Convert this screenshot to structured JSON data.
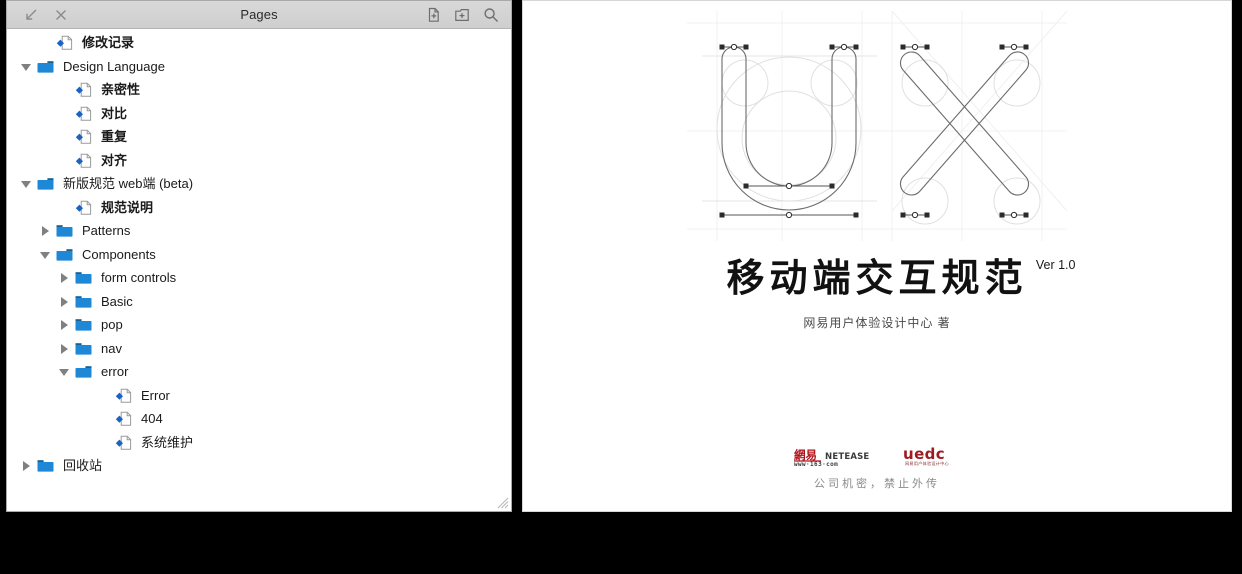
{
  "window": {
    "title": "Pages",
    "left_controls": [
      {
        "name": "collapse-icon",
        "label": "collapse"
      },
      {
        "name": "close-icon",
        "label": "close"
      }
    ],
    "right_controls": [
      {
        "name": "add-page-icon",
        "label": "Add Page"
      },
      {
        "name": "add-folder-icon",
        "label": "Add Folder"
      },
      {
        "name": "search-icon",
        "label": "Search"
      }
    ]
  },
  "tree": {
    "items": [
      {
        "label": "修改记录",
        "type": "page",
        "indent": 1,
        "disclosure": "none",
        "bold": true
      },
      {
        "label": "Design Language",
        "type": "folder-open",
        "indent": 0,
        "disclosure": "open",
        "bold": false
      },
      {
        "label": "亲密性",
        "type": "page",
        "indent": 2,
        "disclosure": "none",
        "bold": true
      },
      {
        "label": "对比",
        "type": "page",
        "indent": 2,
        "disclosure": "none",
        "bold": true
      },
      {
        "label": "重复",
        "type": "page",
        "indent": 2,
        "disclosure": "none",
        "bold": true
      },
      {
        "label": "对齐",
        "type": "page",
        "indent": 2,
        "disclosure": "none",
        "bold": true
      },
      {
        "label": "新版规范 web端 (beta)",
        "type": "folder-open",
        "indent": 0,
        "disclosure": "open",
        "bold": false
      },
      {
        "label": "规范说明",
        "type": "page",
        "indent": 2,
        "disclosure": "none",
        "bold": true
      },
      {
        "label": "Patterns",
        "type": "folder",
        "indent": 1,
        "disclosure": "closed",
        "bold": false
      },
      {
        "label": "Components",
        "type": "folder-open",
        "indent": 1,
        "disclosure": "open",
        "bold": false
      },
      {
        "label": "form controls",
        "type": "folder",
        "indent": 2,
        "disclosure": "closed",
        "bold": false
      },
      {
        "label": "Basic",
        "type": "folder",
        "indent": 2,
        "disclosure": "closed",
        "bold": false
      },
      {
        "label": "pop",
        "type": "folder",
        "indent": 2,
        "disclosure": "closed",
        "bold": false
      },
      {
        "label": "nav",
        "type": "folder",
        "indent": 2,
        "disclosure": "closed",
        "bold": false
      },
      {
        "label": "error",
        "type": "folder-open",
        "indent": 2,
        "disclosure": "open",
        "bold": false
      },
      {
        "label": "Error",
        "type": "page",
        "indent": 4,
        "disclosure": "none",
        "bold": false
      },
      {
        "label": "404",
        "type": "page",
        "indent": 4,
        "disclosure": "none",
        "bold": false
      },
      {
        "label": "系统维护",
        "type": "page",
        "indent": 4,
        "disclosure": "none",
        "bold": false
      },
      {
        "label": "回收站",
        "type": "folder",
        "indent": 0,
        "disclosure": "closed",
        "bold": false
      }
    ]
  },
  "document": {
    "logo_letters": "UX",
    "title": "移动端交互规范",
    "version": "Ver 1.0",
    "subtitle": "网易用户体验设计中心 著",
    "brand_netease_cn": "網易",
    "brand_netease_en": "NETEASE",
    "brand_netease_url": "www·163·com",
    "brand_uedc": "uedc",
    "brand_uedc_sub": "网易用户体验设计中心",
    "confidential": "公司机密，禁止外传"
  },
  "colors": {
    "folder_blue": "#1e87d6",
    "page_diamond": "#1a63c4",
    "netease_red": "#b0121a",
    "uedc_red": "#9e1b22",
    "titlebar": "#d4d4d4"
  }
}
